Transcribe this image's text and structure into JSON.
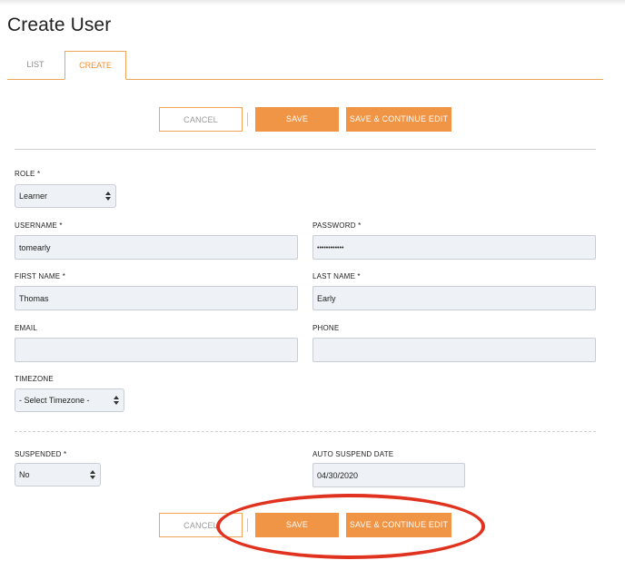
{
  "page": {
    "title": "Create User"
  },
  "tabs": [
    {
      "label": "LIST",
      "active": false
    },
    {
      "label": "CREATE",
      "active": true
    }
  ],
  "actions_top": {
    "cancel_label": "CANCEL",
    "save_label": "SAVE",
    "save_continue_label": "SAVE & CONTINUE EDIT"
  },
  "actions_bottom": {
    "cancel_label": "CANCEL",
    "save_label": "SAVE",
    "save_continue_label": "SAVE & CONTINUE EDIT"
  },
  "form": {
    "role": {
      "label": "ROLE *",
      "value": "Learner"
    },
    "username": {
      "label": "USERNAME *",
      "value": "tomearly"
    },
    "password": {
      "label": "PASSWORD *",
      "value": "••••••••••••"
    },
    "first_name": {
      "label": "FIRST NAME *",
      "value": "Thomas"
    },
    "last_name": {
      "label": "LAST NAME *",
      "value": "Early"
    },
    "email": {
      "label": "EMAIL",
      "value": ""
    },
    "phone": {
      "label": "PHONE",
      "value": ""
    },
    "timezone": {
      "label": "TIMEZONE",
      "value": "- Select Timezone -"
    },
    "suspended": {
      "label": "SUSPENDED *",
      "value": "No"
    },
    "auto_suspend_date": {
      "label": "AUTO SUSPEND DATE",
      "value": "04/30/2020"
    }
  },
  "colors": {
    "accent": "#f09445",
    "annotation": "#e0321e",
    "field_bg": "#eef1f5"
  }
}
